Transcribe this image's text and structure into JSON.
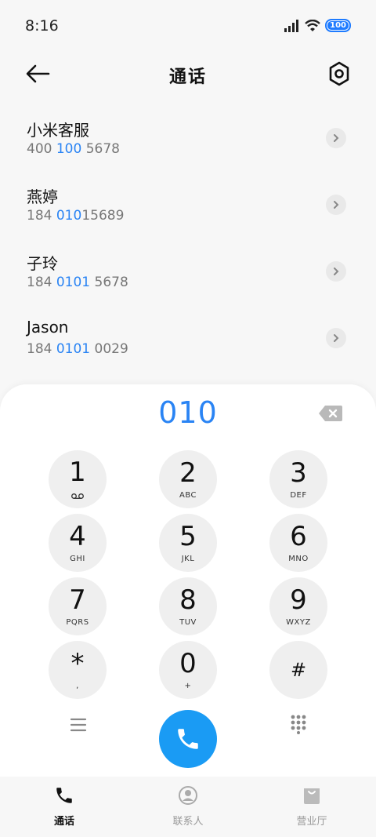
{
  "status": {
    "time": "8:16",
    "battery": "100"
  },
  "header": {
    "title": "通话"
  },
  "results": [
    {
      "name": "小米客服",
      "number_parts": [
        "400 ",
        "100",
        " 5678"
      ]
    },
    {
      "name": "燕婷",
      "number_parts": [
        "184 ",
        "010",
        "15689"
      ]
    },
    {
      "name": "子玲",
      "number_parts": [
        "184 ",
        "0101",
        " 5678"
      ]
    },
    {
      "name": "Jason",
      "number_parts": [
        "184 ",
        "0101",
        " 0029"
      ]
    }
  ],
  "dialpad": {
    "typed": "010",
    "keys": [
      {
        "digit": "1",
        "letters": ""
      },
      {
        "digit": "2",
        "letters": "ABC"
      },
      {
        "digit": "3",
        "letters": "DEF"
      },
      {
        "digit": "4",
        "letters": "GHI"
      },
      {
        "digit": "5",
        "letters": "JKL"
      },
      {
        "digit": "6",
        "letters": "MNO"
      },
      {
        "digit": "7",
        "letters": "PQRS"
      },
      {
        "digit": "8",
        "letters": "TUV"
      },
      {
        "digit": "9",
        "letters": "WXYZ"
      },
      {
        "digit": "*",
        "letters": ","
      },
      {
        "digit": "0",
        "letters": "+"
      },
      {
        "digit": "#",
        "letters": ""
      }
    ]
  },
  "tabs": [
    {
      "label": "通话",
      "icon": "phone-icon",
      "active": true
    },
    {
      "label": "联系人",
      "icon": "person-icon",
      "active": false
    },
    {
      "label": "营业厅",
      "icon": "shopping-bag-icon",
      "active": false
    }
  ],
  "colors": {
    "accent": "#2a84f4",
    "call_button": "#1a9bf4",
    "key_bg": "#efefef"
  }
}
